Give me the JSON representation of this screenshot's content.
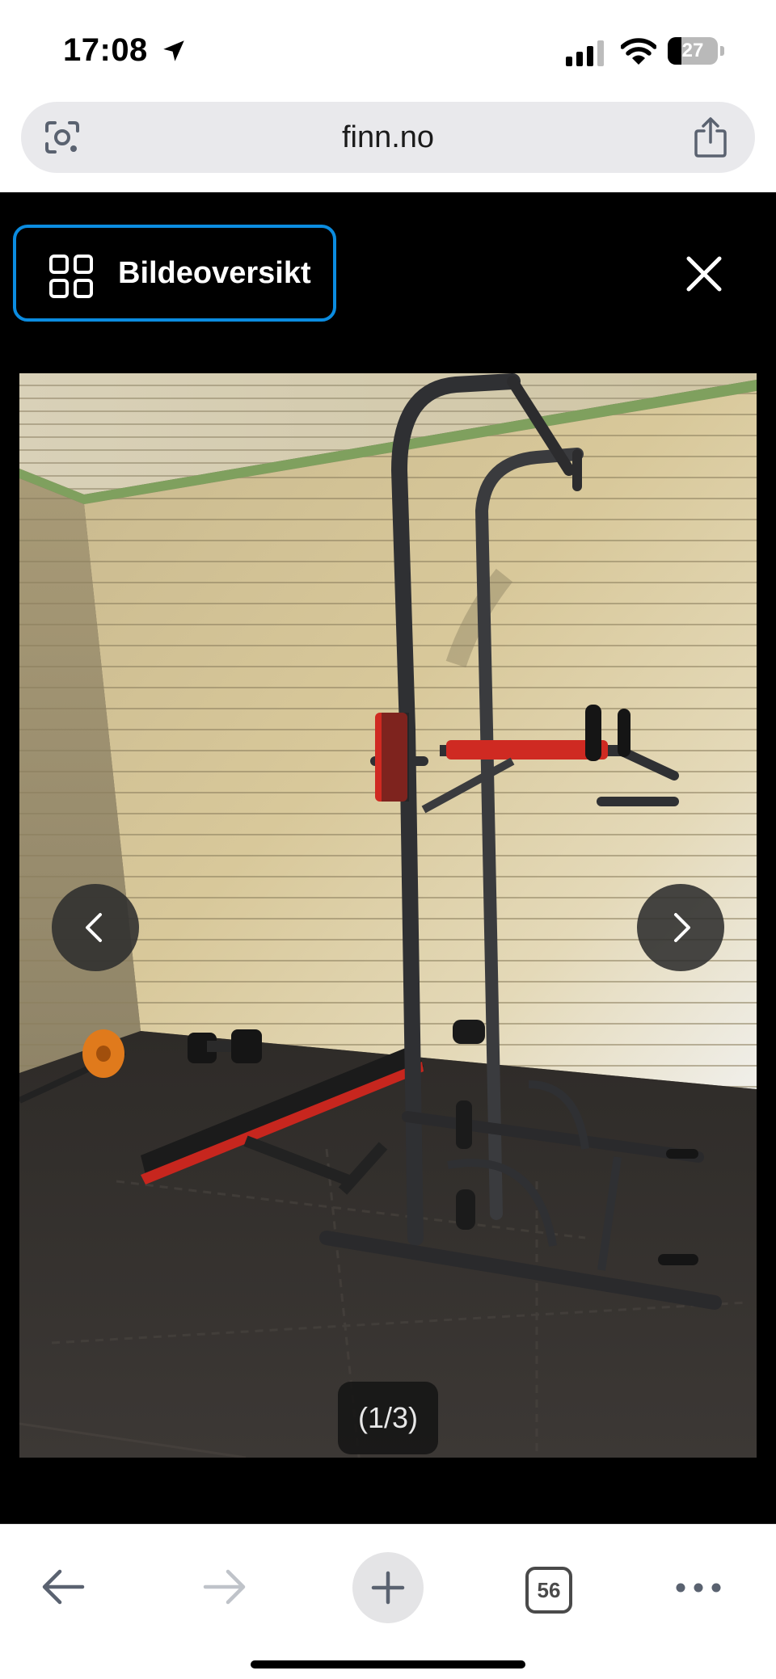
{
  "status_bar": {
    "time": "17:08",
    "battery_level": "27",
    "battery_fraction": 0.27
  },
  "address_bar": {
    "url": "finn.no",
    "left_icon": "lens-icon",
    "right_icon": "share-icon"
  },
  "viewer": {
    "overview_label": "Bildeoversikt",
    "overview_icon": "grid-icon",
    "close_icon": "close-icon",
    "prev_icon": "chevron-left-icon",
    "next_icon": "chevron-right-icon",
    "counter": "(1/3)",
    "accent_color": "#0b8ce0"
  },
  "toolbar": {
    "back_icon": "arrow-left-icon",
    "forward_icon": "arrow-right-icon",
    "new_tab_icon": "plus-icon",
    "tab_count": "56",
    "more_icon": "ellipsis-icon"
  }
}
